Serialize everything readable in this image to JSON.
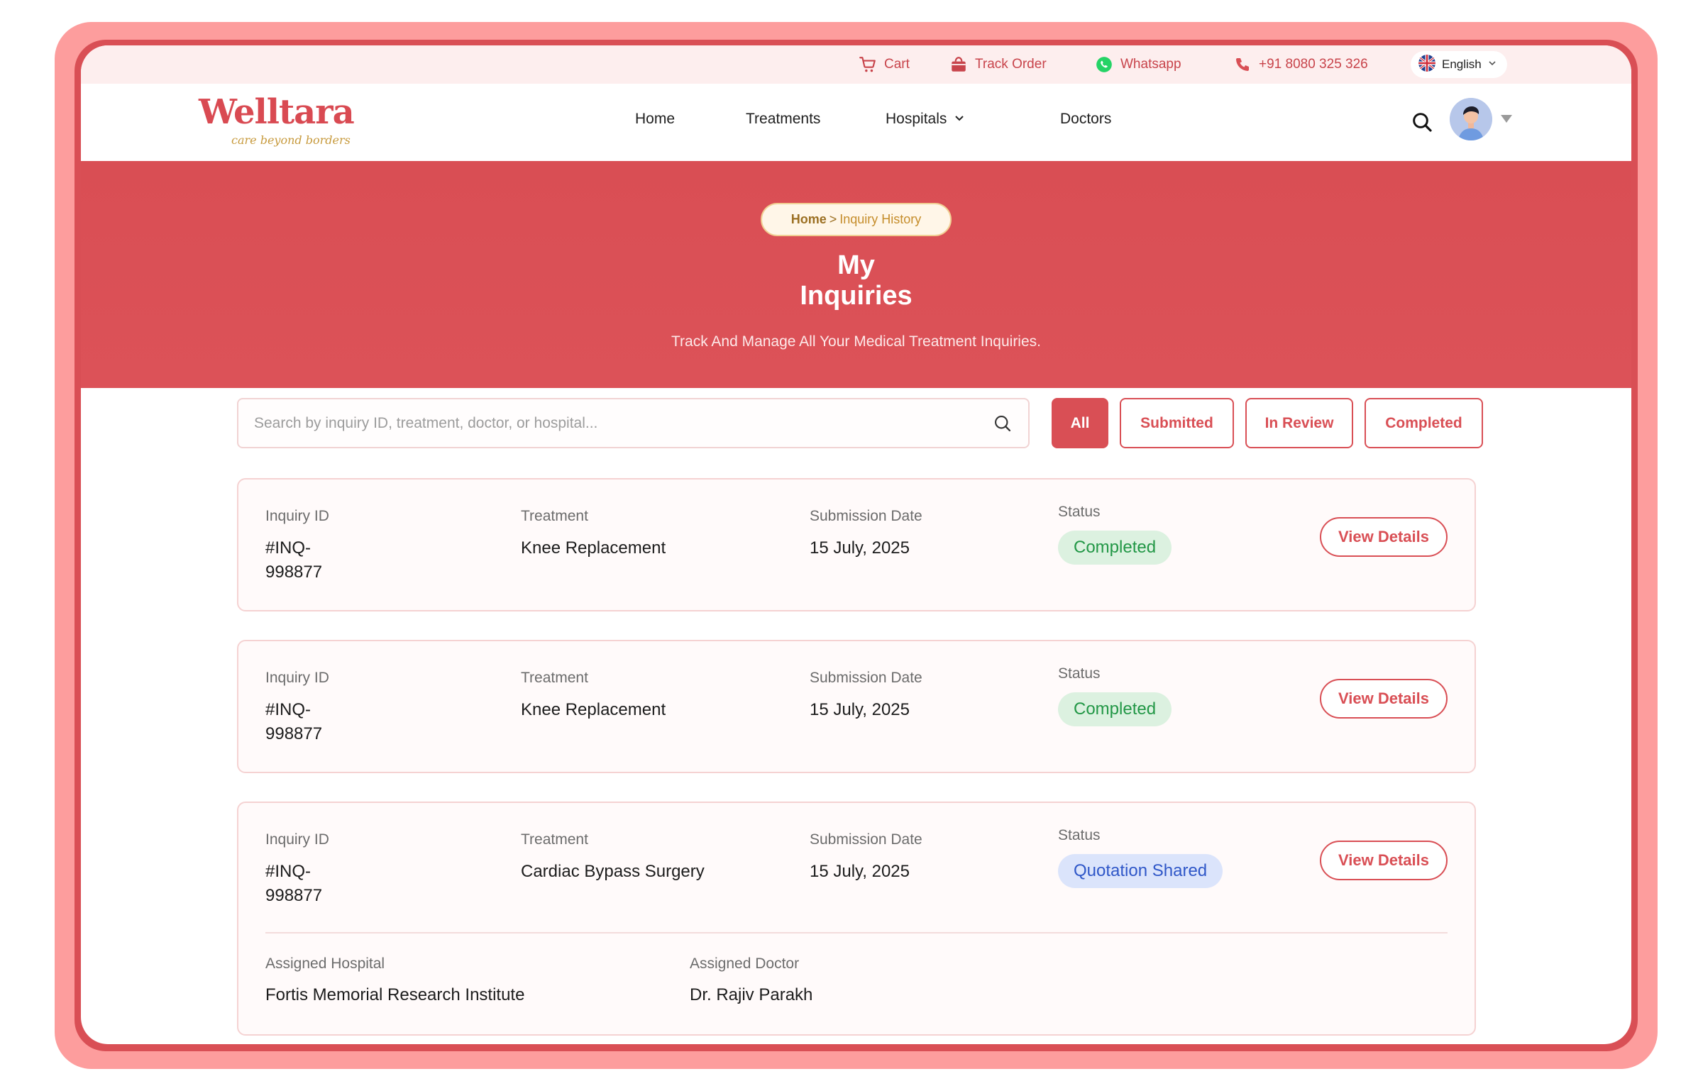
{
  "topbar": {
    "cart": "Cart",
    "track_order": "Track Order",
    "whatsapp": "Whatsapp",
    "phone": "+91 8080 325 326",
    "language": "English"
  },
  "brand": {
    "name": "Welltara",
    "tagline": "care beyond borders",
    "primary_color": "#d94f55"
  },
  "nav": {
    "home": "Home",
    "treatments": "Treatments",
    "hospitals": "Hospitals",
    "doctors": "Doctors"
  },
  "hero": {
    "breadcrumb_home": "Home",
    "breadcrumb_sep": ">",
    "breadcrumb_current": "Inquiry History",
    "title_line1": "My",
    "title_line2": "Inquiries",
    "subtitle": "Track And Manage All Your Medical Treatment Inquiries."
  },
  "filters": {
    "search_placeholder": "Search by inquiry ID, treatment, doctor, or hospital...",
    "all": "All",
    "submitted": "Submitted",
    "in_review": "In Review",
    "completed": "Completed",
    "active": "All"
  },
  "labels": {
    "inquiry_id": "Inquiry ID",
    "treatment": "Treatment",
    "submission_date": "Submission Date",
    "status": "Status",
    "view_details": "View Details",
    "assigned_hospital": "Assigned Hospital",
    "assigned_doctor": "Assigned Doctor"
  },
  "inquiries": [
    {
      "id": "#INQ-998877",
      "treatment": "Knee Replacement",
      "date": "15 July, 2025",
      "status": "Completed"
    },
    {
      "id": "#INQ-998877",
      "treatment": "Knee Replacement",
      "date": "15 July, 2025",
      "status": "Completed"
    },
    {
      "id": "#INQ-998877",
      "treatment": "Cardiac Bypass Surgery",
      "date": "15 July, 2025",
      "status": "Quotation Shared",
      "hospital": "Fortis Memorial Research Institute",
      "doctor": "Dr. Rajiv Parakh"
    }
  ]
}
